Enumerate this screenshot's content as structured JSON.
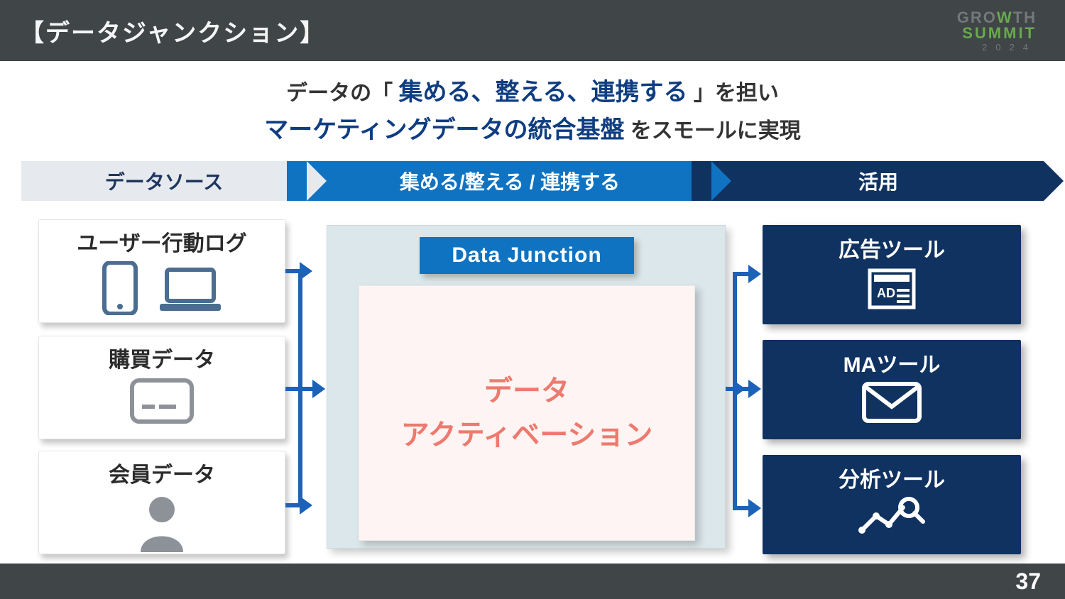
{
  "header": {
    "title": "【データジャンクション】",
    "logo": {
      "line1a": "GRO",
      "line1b": "TH",
      "line2": "SUMMIT",
      "line3": "2024"
    }
  },
  "subtitle": {
    "pre1": "データの「",
    "hl1": "集める、整える、連携する",
    "post1": "」を担い",
    "hl2": "マーケティングデータの統合基盤",
    "post2": " をスモールに実現"
  },
  "stages": [
    "データソース",
    "集める/整える / 連携する",
    "活用"
  ],
  "sources": [
    {
      "title": "ユーザー行動ログ"
    },
    {
      "title": "購買データ"
    },
    {
      "title": "会員データ"
    }
  ],
  "center": {
    "badge": "Data Junction",
    "activation_l1": "データ",
    "activation_l2": "アクティベーション"
  },
  "outputs": [
    {
      "title": "広告ツール"
    },
    {
      "title": "MAツール"
    },
    {
      "title": "分析ツール"
    }
  ],
  "page_number": "37"
}
